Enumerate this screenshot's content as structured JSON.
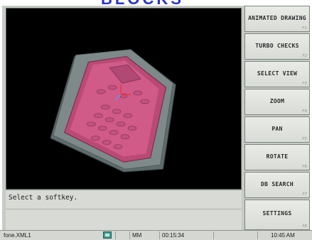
{
  "window": {
    "title": "BLOCKS"
  },
  "viewport": {
    "description_icon": "3d-part-view-icon"
  },
  "status": {
    "prompt": "Select a softkey."
  },
  "softkeys": [
    {
      "label": "ANIMATED DRAWING",
      "fkey": "F1"
    },
    {
      "label": "TURBO CHECKS",
      "fkey": "F2"
    },
    {
      "label": "SELECT VIEW",
      "fkey": "F3"
    },
    {
      "label": "ZOOM",
      "fkey": "F4"
    },
    {
      "label": "PAN",
      "fkey": "F5"
    },
    {
      "label": "ROTATE",
      "fkey": "F6"
    },
    {
      "label": "DB SEARCH",
      "fkey": "F7"
    },
    {
      "label": "SETTINGS",
      "fkey": "F8"
    }
  ],
  "taskbar": {
    "filename": "fone.XML1",
    "units": "MM",
    "elapsed": "00:15:34",
    "clock": "10:45 AM"
  },
  "colors": {
    "part": "#c9507f",
    "tray": "#6f7a7c",
    "accent_title": "#2a34c8"
  }
}
